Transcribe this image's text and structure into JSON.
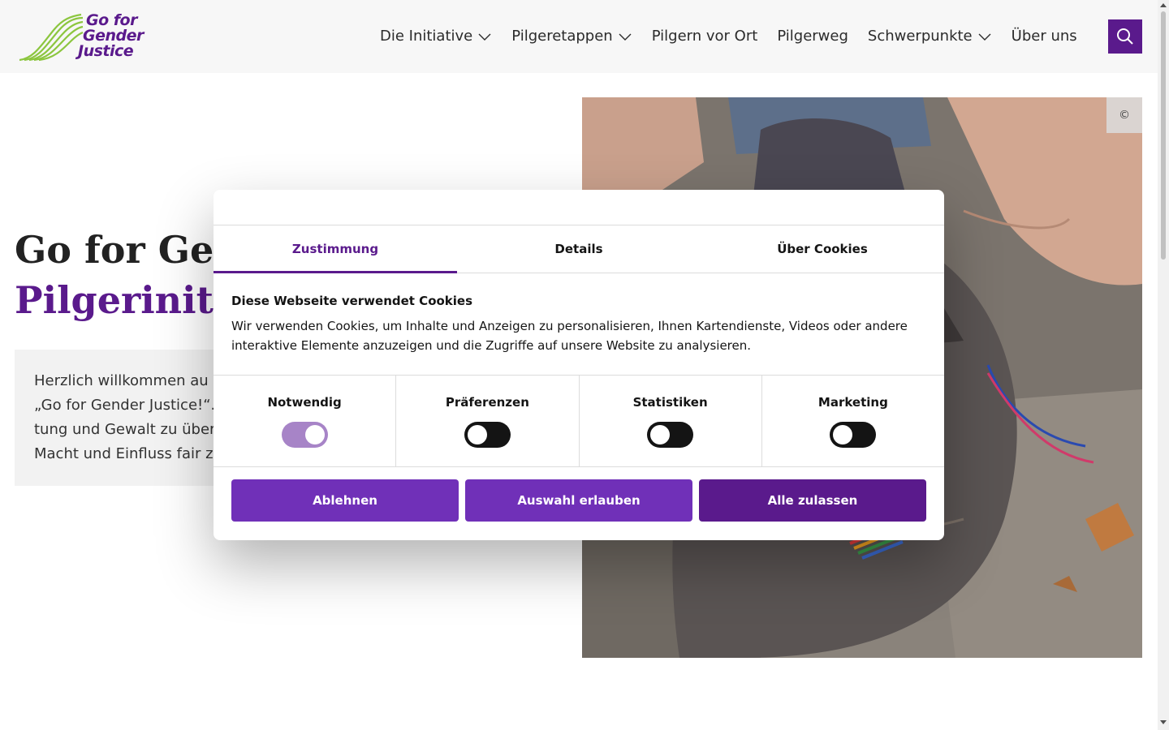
{
  "brand": {
    "logo_lines": [
      "Go for",
      "Gender",
      "Justice"
    ],
    "accent_color": "#5a1a8c"
  },
  "nav": {
    "items": [
      {
        "label": "Die Initiative",
        "has_dropdown": true
      },
      {
        "label": "Pilgeretappen",
        "has_dropdown": true
      },
      {
        "label": "Pilgern vor Ort",
        "has_dropdown": false
      },
      {
        "label": "Pilgerweg",
        "has_dropdown": false
      },
      {
        "label": "Schwerpunkte",
        "has_dropdown": true
      },
      {
        "label": "Über uns",
        "has_dropdown": false
      }
    ],
    "search_icon": "search-icon"
  },
  "hero": {
    "title_visible": "Go for Gend",
    "subtitle_visible": "Pilgerinitia",
    "intro_lines": [
      "Herzlich willkommen au",
      "„Go for Gender Justice!“.",
      "tung und Gewalt zu über",
      "Macht und Einfluss fair z"
    ],
    "image_copyright": "©"
  },
  "cookie_dialog": {
    "tabs": [
      {
        "label": "Zustimmung",
        "active": true
      },
      {
        "label": "Details",
        "active": false
      },
      {
        "label": "Über Cookies",
        "active": false
      }
    ],
    "heading": "Diese Webseite verwendet Cookies",
    "text": "Wir verwenden Cookies, um Inhalte und Anzeigen zu personalisieren, Ihnen Kartendienste, Videos oder andere interaktive Elemente anzuzeigen und die Zugriffe auf unsere Website zu analysieren.",
    "categories": [
      {
        "label": "Notwendig",
        "enabled": true,
        "disabled": true
      },
      {
        "label": "Präferenzen",
        "enabled": false,
        "disabled": false
      },
      {
        "label": "Statistiken",
        "enabled": false,
        "disabled": false
      },
      {
        "label": "Marketing",
        "enabled": false,
        "disabled": false
      }
    ],
    "buttons": {
      "deny": "Ablehnen",
      "allow_selection": "Auswahl erlauben",
      "allow_all": "Alle zulassen"
    }
  }
}
